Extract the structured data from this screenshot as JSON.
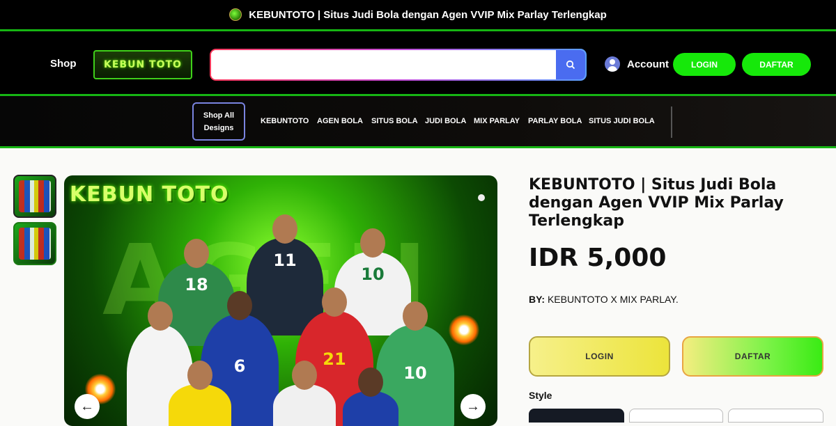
{
  "announcement": {
    "text": "KEBUNTOTO | Situs Judi Bola dengan Agen VVIP Mix Parlay Terlengkap"
  },
  "header": {
    "shop_label": "Shop",
    "logo_text": "KEBUN TOTO",
    "search": {
      "value": "",
      "placeholder": ""
    },
    "account_label": "Account",
    "login_label": "LOGIN",
    "daftar_label": "DAFTAR"
  },
  "nav": {
    "shop_all_label": "Shop All Designs",
    "items": [
      "KEBUNTOTO",
      "AGEN BOLA",
      "SITUS BOLA",
      "JUDI BOLA",
      "MIX PARLAY",
      "PARLAY BOLA",
      "SITUS JUDI BOLA"
    ]
  },
  "gallery": {
    "logo_text": "KEBUN TOTO",
    "watermark_text": "AGEN",
    "jersey_numbers": [
      "18",
      "11",
      "10",
      "6",
      "21",
      "10"
    ]
  },
  "product": {
    "title": "KEBUNTOTO | Situs Judi Bola dengan Agen VVIP Mix Parlay Terlengkap",
    "price": "IDR 5,000",
    "by_prefix": "BY:",
    "by_value": "KEBUNTOTO X MIX PARLAY.",
    "login_label": "LOGIN",
    "daftar_label": "DAFTAR",
    "style_label": "Style"
  },
  "colors": {
    "accent_green": "#16e80a",
    "divider_green": "#16b513",
    "search_button": "#4a6cf0"
  }
}
